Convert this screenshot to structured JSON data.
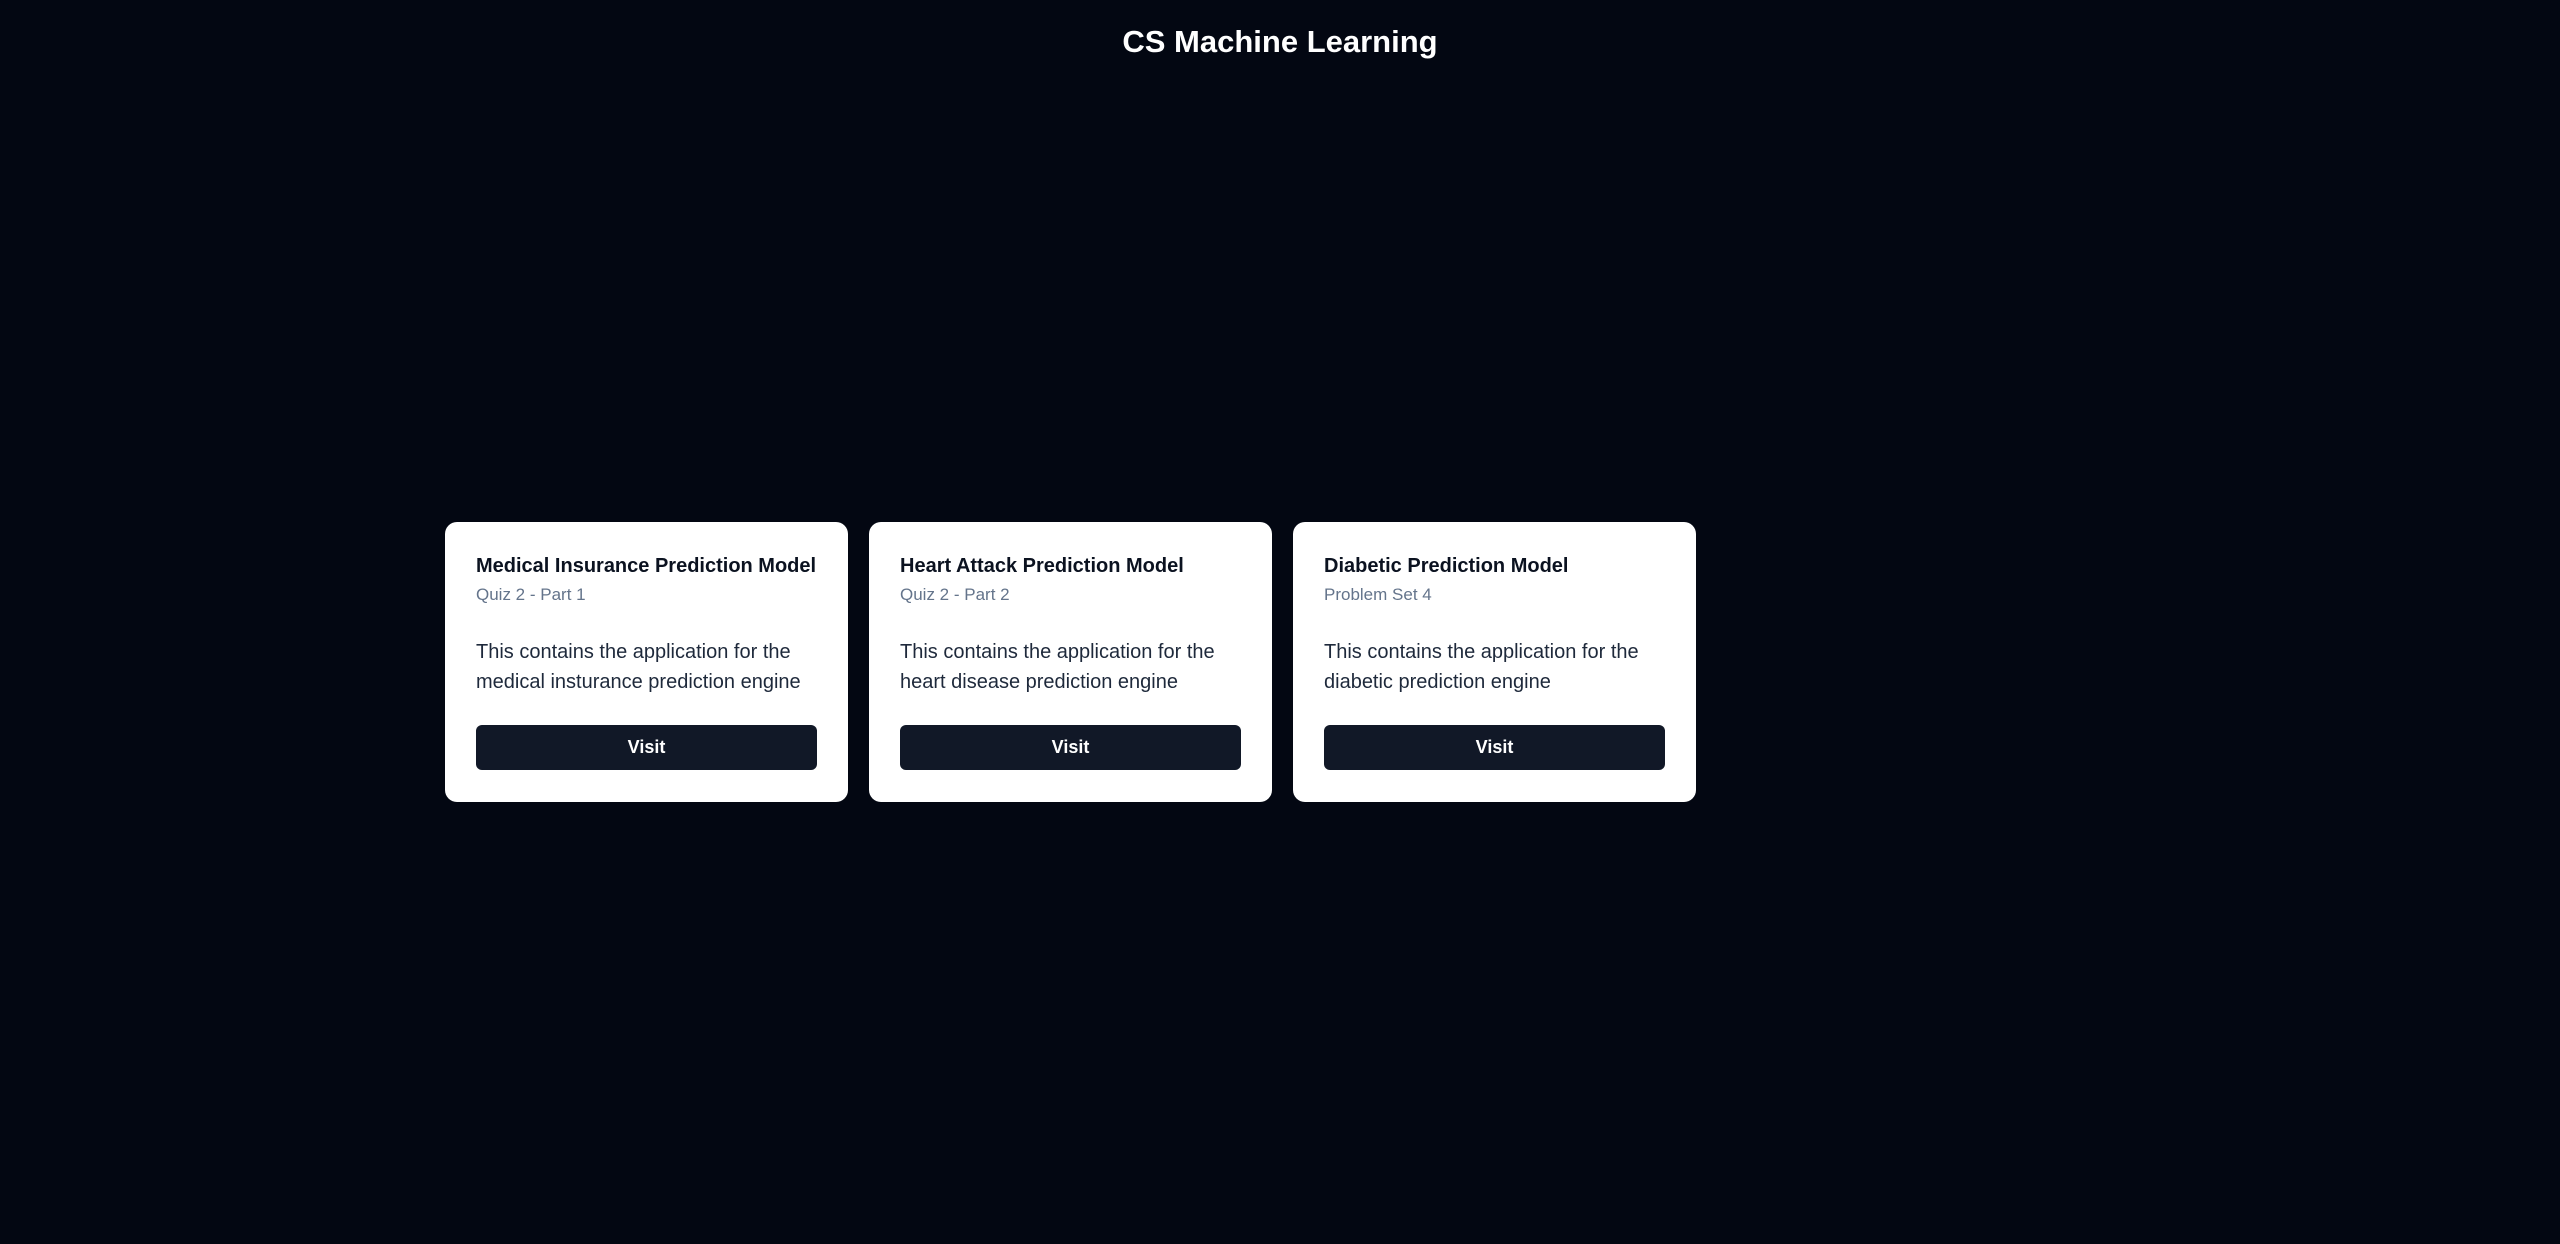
{
  "header": {
    "title": "CS Machine Learning"
  },
  "cards": [
    {
      "title": "Medical Insurance Prediction Model",
      "subtitle": "Quiz 2 - Part 1",
      "description": "This contains the application for the medical insturance prediction engine",
      "button_label": "Visit"
    },
    {
      "title": "Heart Attack Prediction Model",
      "subtitle": "Quiz 2 - Part 2",
      "description": "This contains the application for the heart disease prediction engine",
      "button_label": "Visit"
    },
    {
      "title": "Diabetic Prediction Model",
      "subtitle": "Problem Set 4",
      "description": "This contains the application for the diabetic prediction engine",
      "button_label": "Visit"
    }
  ],
  "colors": {
    "background": "#030712",
    "card": "#ffffff",
    "button": "#111827",
    "subtitle": "#64748b"
  }
}
